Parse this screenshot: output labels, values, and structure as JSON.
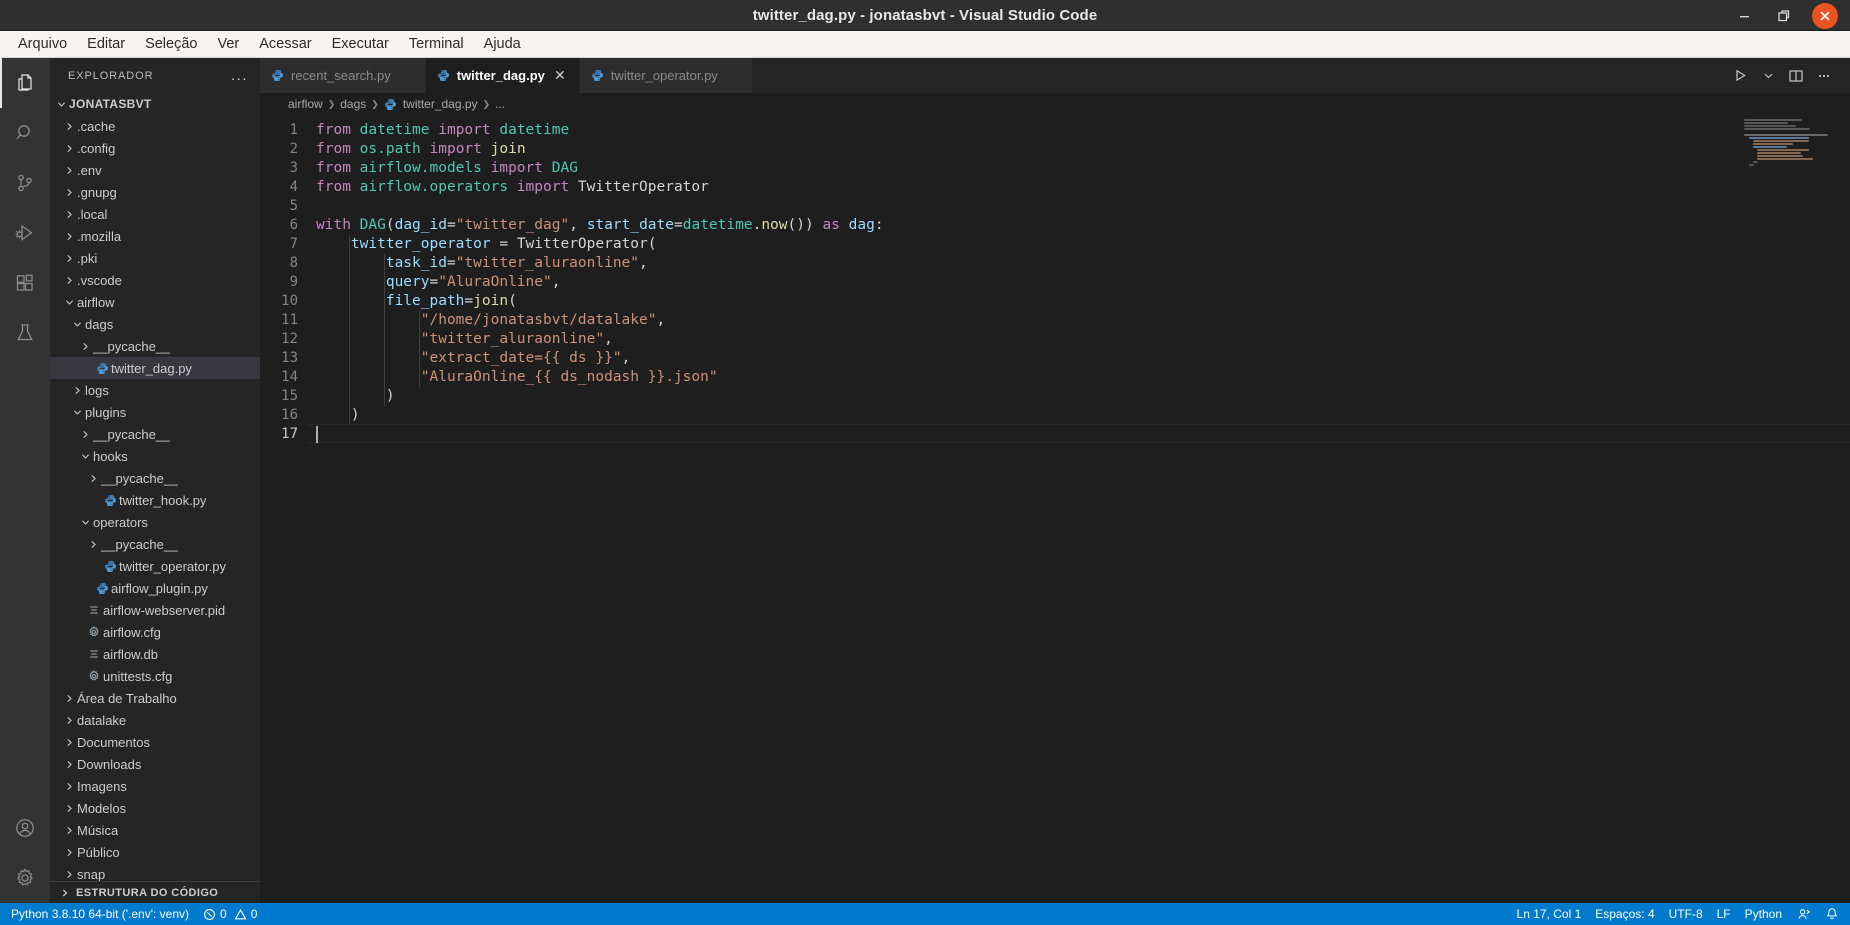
{
  "window": {
    "title": "twitter_dag.py - jonatasbvt - Visual Studio Code",
    "minimize_label": "minimize-window",
    "maximize_label": "maximize-window",
    "close_label": "close-window",
    "accent_close": "#e95420"
  },
  "menubar": {
    "items": [
      {
        "label": "Arquivo"
      },
      {
        "label": "Editar"
      },
      {
        "label": "Seleção"
      },
      {
        "label": "Ver"
      },
      {
        "label": "Acessar"
      },
      {
        "label": "Executar"
      },
      {
        "label": "Terminal"
      },
      {
        "label": "Ajuda"
      }
    ]
  },
  "activity_bar": {
    "top": [
      {
        "name": "explorer-icon",
        "active": true
      },
      {
        "name": "search-icon",
        "active": false
      },
      {
        "name": "source-control-icon",
        "active": false
      },
      {
        "name": "run-and-debug-icon",
        "active": false
      },
      {
        "name": "extensions-icon",
        "active": false
      },
      {
        "name": "testing-icon",
        "active": false
      }
    ],
    "bottom": [
      {
        "name": "account-icon"
      },
      {
        "name": "settings-gear-icon"
      }
    ]
  },
  "sidebar": {
    "title": "EXPLORADOR",
    "more_actions": "...",
    "outline_panel_label": "ESTRUTURA DO CÓDIGO",
    "tree": [
      {
        "label": "JONATASBVT",
        "depth": 0,
        "type": "root",
        "state": "expanded"
      },
      {
        "label": ".cache",
        "depth": 1,
        "type": "folder",
        "state": "collapsed"
      },
      {
        "label": ".config",
        "depth": 1,
        "type": "folder",
        "state": "collapsed"
      },
      {
        "label": ".env",
        "depth": 1,
        "type": "folder",
        "state": "collapsed"
      },
      {
        "label": ".gnupg",
        "depth": 1,
        "type": "folder",
        "state": "collapsed"
      },
      {
        "label": ".local",
        "depth": 1,
        "type": "folder",
        "state": "collapsed"
      },
      {
        "label": ".mozilla",
        "depth": 1,
        "type": "folder",
        "state": "collapsed"
      },
      {
        "label": ".pki",
        "depth": 1,
        "type": "folder",
        "state": "collapsed"
      },
      {
        "label": ".vscode",
        "depth": 1,
        "type": "folder",
        "state": "collapsed"
      },
      {
        "label": "airflow",
        "depth": 1,
        "type": "folder",
        "state": "expanded"
      },
      {
        "label": "dags",
        "depth": 2,
        "type": "folder",
        "state": "expanded"
      },
      {
        "label": "__pycache__",
        "depth": 3,
        "type": "folder",
        "state": "collapsed"
      },
      {
        "label": "twitter_dag.py",
        "depth": 3,
        "type": "python",
        "state": "file",
        "selected": true
      },
      {
        "label": "logs",
        "depth": 2,
        "type": "folder",
        "state": "collapsed"
      },
      {
        "label": "plugins",
        "depth": 2,
        "type": "folder",
        "state": "expanded"
      },
      {
        "label": "__pycache__",
        "depth": 3,
        "type": "folder",
        "state": "collapsed"
      },
      {
        "label": "hooks",
        "depth": 3,
        "type": "folder",
        "state": "expanded"
      },
      {
        "label": "__pycache__",
        "depth": 4,
        "type": "folder",
        "state": "collapsed"
      },
      {
        "label": "twitter_hook.py",
        "depth": 4,
        "type": "python",
        "state": "file"
      },
      {
        "label": "operators",
        "depth": 3,
        "type": "folder",
        "state": "expanded"
      },
      {
        "label": "__pycache__",
        "depth": 4,
        "type": "folder",
        "state": "collapsed"
      },
      {
        "label": "twitter_operator.py",
        "depth": 4,
        "type": "python",
        "state": "file"
      },
      {
        "label": "airflow_plugin.py",
        "depth": 3,
        "type": "python",
        "state": "file"
      },
      {
        "label": "airflow-webserver.pid",
        "depth": 2,
        "type": "text",
        "state": "file"
      },
      {
        "label": "airflow.cfg",
        "depth": 2,
        "type": "config",
        "state": "file"
      },
      {
        "label": "airflow.db",
        "depth": 2,
        "type": "text",
        "state": "file"
      },
      {
        "label": "unittests.cfg",
        "depth": 2,
        "type": "config",
        "state": "file"
      },
      {
        "label": "Área de Trabalho",
        "depth": 1,
        "type": "folder",
        "state": "collapsed"
      },
      {
        "label": "datalake",
        "depth": 1,
        "type": "folder",
        "state": "collapsed"
      },
      {
        "label": "Documentos",
        "depth": 1,
        "type": "folder",
        "state": "collapsed"
      },
      {
        "label": "Downloads",
        "depth": 1,
        "type": "folder",
        "state": "collapsed"
      },
      {
        "label": "Imagens",
        "depth": 1,
        "type": "folder",
        "state": "collapsed"
      },
      {
        "label": "Modelos",
        "depth": 1,
        "type": "folder",
        "state": "collapsed"
      },
      {
        "label": "Música",
        "depth": 1,
        "type": "folder",
        "state": "collapsed"
      },
      {
        "label": "Público",
        "depth": 1,
        "type": "folder",
        "state": "collapsed"
      },
      {
        "label": "snap",
        "depth": 1,
        "type": "folder",
        "state": "collapsed"
      }
    ]
  },
  "editor": {
    "tabs": [
      {
        "label": "recent_search.py",
        "active": false,
        "icon": "python-icon",
        "dirty": false
      },
      {
        "label": "twitter_dag.py",
        "active": true,
        "icon": "python-icon",
        "close": "✕"
      },
      {
        "label": "twitter_operator.py",
        "active": false,
        "icon": "python-icon",
        "dirty": false
      }
    ],
    "actions": [
      {
        "name": "run-python-file-icon",
        "label": "▷"
      },
      {
        "name": "run-chevron-down-icon",
        "label": "⌄"
      },
      {
        "name": "split-editor-right-icon",
        "label": "▯"
      },
      {
        "name": "more-actions-icon",
        "label": "···"
      }
    ],
    "breadcrumb": [
      "airflow",
      "dags",
      "twitter_dag.py",
      "..."
    ],
    "language": "Python",
    "lines": [
      {
        "n": 1,
        "tokens": [
          {
            "t": "from ",
            "c": "kw"
          },
          {
            "t": "datetime",
            "c": "mod"
          },
          {
            "t": " ",
            "c": "plain"
          },
          {
            "t": "import",
            "c": "kw"
          },
          {
            "t": " ",
            "c": "plain"
          },
          {
            "t": "datetime",
            "c": "cls"
          }
        ]
      },
      {
        "n": 2,
        "tokens": [
          {
            "t": "from ",
            "c": "kw"
          },
          {
            "t": "os.path",
            "c": "mod"
          },
          {
            "t": " ",
            "c": "plain"
          },
          {
            "t": "import",
            "c": "kw"
          },
          {
            "t": " ",
            "c": "plain"
          },
          {
            "t": "join",
            "c": "fn"
          }
        ]
      },
      {
        "n": 3,
        "tokens": [
          {
            "t": "from ",
            "c": "kw"
          },
          {
            "t": "airflow.models",
            "c": "mod"
          },
          {
            "t": " ",
            "c": "plain"
          },
          {
            "t": "import",
            "c": "kw"
          },
          {
            "t": " ",
            "c": "plain"
          },
          {
            "t": "DAG",
            "c": "cls"
          }
        ]
      },
      {
        "n": 4,
        "tokens": [
          {
            "t": "from ",
            "c": "kw"
          },
          {
            "t": "airflow.operators",
            "c": "mod"
          },
          {
            "t": " ",
            "c": "plain"
          },
          {
            "t": "import",
            "c": "kw"
          },
          {
            "t": " ",
            "c": "plain"
          },
          {
            "t": "TwitterOperator",
            "c": "plain"
          }
        ]
      },
      {
        "n": 5,
        "tokens": []
      },
      {
        "n": 6,
        "tokens": [
          {
            "t": "with ",
            "c": "kw"
          },
          {
            "t": "DAG",
            "c": "cls"
          },
          {
            "t": "(",
            "c": "pun"
          },
          {
            "t": "dag_id",
            "c": "var"
          },
          {
            "t": "=",
            "c": "pun"
          },
          {
            "t": "\"twitter_dag\"",
            "c": "str"
          },
          {
            "t": ", ",
            "c": "pun"
          },
          {
            "t": "start_date",
            "c": "var"
          },
          {
            "t": "=",
            "c": "pun"
          },
          {
            "t": "datetime",
            "c": "mod"
          },
          {
            "t": ".",
            "c": "pun"
          },
          {
            "t": "now",
            "c": "fn"
          },
          {
            "t": "()) ",
            "c": "pun"
          },
          {
            "t": "as",
            "c": "kw"
          },
          {
            "t": " ",
            "c": "plain"
          },
          {
            "t": "dag",
            "c": "var"
          },
          {
            "t": ":",
            "c": "pun"
          }
        ]
      },
      {
        "n": 7,
        "tokens": [
          {
            "t": "    ",
            "c": "plain"
          },
          {
            "t": "twitter_operator",
            "c": "var"
          },
          {
            "t": " = ",
            "c": "pun"
          },
          {
            "t": "TwitterOperator",
            "c": "plain"
          },
          {
            "t": "(",
            "c": "pun"
          }
        ]
      },
      {
        "n": 8,
        "tokens": [
          {
            "t": "        ",
            "c": "plain"
          },
          {
            "t": "task_id",
            "c": "var"
          },
          {
            "t": "=",
            "c": "pun"
          },
          {
            "t": "\"twitter_aluraonline\"",
            "c": "str"
          },
          {
            "t": ",",
            "c": "pun"
          }
        ]
      },
      {
        "n": 9,
        "tokens": [
          {
            "t": "        ",
            "c": "plain"
          },
          {
            "t": "query",
            "c": "var"
          },
          {
            "t": "=",
            "c": "pun"
          },
          {
            "t": "\"AluraOnline\"",
            "c": "str"
          },
          {
            "t": ",",
            "c": "pun"
          }
        ]
      },
      {
        "n": 10,
        "tokens": [
          {
            "t": "        ",
            "c": "plain"
          },
          {
            "t": "file_path",
            "c": "var"
          },
          {
            "t": "=",
            "c": "pun"
          },
          {
            "t": "join",
            "c": "fn"
          },
          {
            "t": "(",
            "c": "pun"
          }
        ]
      },
      {
        "n": 11,
        "tokens": [
          {
            "t": "            ",
            "c": "plain"
          },
          {
            "t": "\"/home/jonatasbvt/datalake\"",
            "c": "str"
          },
          {
            "t": ",",
            "c": "pun"
          }
        ]
      },
      {
        "n": 12,
        "tokens": [
          {
            "t": "            ",
            "c": "plain"
          },
          {
            "t": "\"twitter_aluraonline\"",
            "c": "str"
          },
          {
            "t": ",",
            "c": "pun"
          }
        ]
      },
      {
        "n": 13,
        "tokens": [
          {
            "t": "            ",
            "c": "plain"
          },
          {
            "t": "\"extract_date={{ ds }}\"",
            "c": "str"
          },
          {
            "t": ",",
            "c": "pun"
          }
        ]
      },
      {
        "n": 14,
        "tokens": [
          {
            "t": "            ",
            "c": "plain"
          },
          {
            "t": "\"AluraOnline_{{ ds_nodash }}.json\"",
            "c": "str"
          }
        ]
      },
      {
        "n": 15,
        "tokens": [
          {
            "t": "        ",
            "c": "plain"
          },
          {
            "t": ")",
            "c": "pun"
          }
        ]
      },
      {
        "n": 16,
        "tokens": [
          {
            "t": "    ",
            "c": "plain"
          },
          {
            "t": ")",
            "c": "pun"
          }
        ]
      },
      {
        "n": 17,
        "tokens": []
      }
    ]
  },
  "status_bar": {
    "left": [
      {
        "name": "python-interpreter",
        "label": "Python 3.8.10 64-bit ('.env': venv)"
      },
      {
        "name": "problems",
        "errors": "0",
        "warnings": "0"
      }
    ],
    "right": [
      {
        "name": "cursor-position",
        "label": "Ln 17, Col 1"
      },
      {
        "name": "indentation",
        "label": "Espaços: 4"
      },
      {
        "name": "encoding",
        "label": "UTF-8"
      },
      {
        "name": "end-of-line",
        "label": "LF"
      },
      {
        "name": "language-mode",
        "label": "Python"
      }
    ],
    "background": "#007acc"
  }
}
